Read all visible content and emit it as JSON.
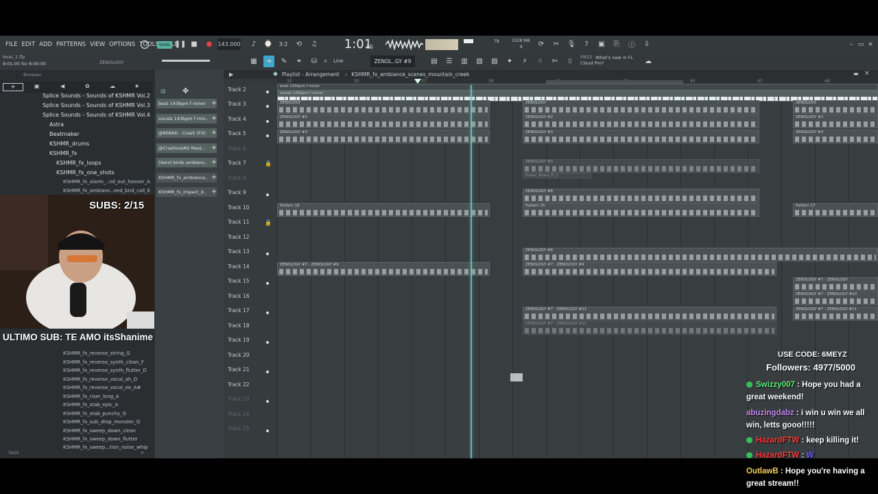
{
  "menu": [
    "FILE",
    "EDIT",
    "ADD",
    "PATTERNS",
    "VIEW",
    "OPTIONS",
    "TOOLS",
    "HELP"
  ],
  "transport": {
    "song_badge": "SONG",
    "tempo": "143.000",
    "time": "1:01",
    "time_ms": "85",
    "pattern": "ZENOL..GY #9",
    "cpu": "3328 MB",
    "cpu2": "6",
    "cpu_top": "78",
    "news_date": "09/12",
    "news": "What's new in FL Cloud Pro?"
  },
  "toolbar2": {
    "snap": "Line"
  },
  "browser": {
    "file_name": "beat_2.flp",
    "time_info": "9:01:00 for 8:00:00",
    "user": "ZENOLOGY",
    "title": "Browser",
    "folders": [
      "Splice Sounds - Sounds of KSHMR Vol.2",
      "Splice Sounds - Sounds of KSHMR Vol.3",
      "Splice Sounds - Sounds of KSHMR Vol.4",
      "Astra",
      "Beatmaker",
      "KSHMR_drums",
      "KSHMR_fx",
      "KSHMR_fx_loops",
      "KSHMR_fx_one_shots"
    ],
    "files_top": [
      "KSHMR_fx_alarm_..nd_out_hoover_A",
      "KSHMR_fx_ambianc..ned_bird_call_E"
    ],
    "files_bottom": [
      "KSHMR_fx_reverse_string_G",
      "KSHMR_fx_reverse_synth_clean_F",
      "KSHMR_fx_reverse_synth_flutter_D",
      "KSHMR_fx_reverse_vocal_ah_D",
      "KSHMR_fx_reverse_vocal_ee_A#",
      "KSHMR_fx_riser_long_A",
      "KSHMR_fx_stab_epic_A",
      "KSHMR_fx_stab_punchy_G",
      "KSHMR_fx_sub_drop_monster_G",
      "KSHMR_fx_sweep_down_clean",
      "KSHMR_fx_sweep_down_flutter",
      "KSHMR_fx_sweep...tion_noise_whip"
    ],
    "tags": "TAGS"
  },
  "channels": [
    "beat 143bpm f minor",
    "vocals 143bpm f min..",
    "@808AD - Crash (FX)",
    "@CrashoutAD  MaxL..",
    "(Xero) birds ambienc..",
    "KSHMR_fx_ambiance..",
    "KSHMR_fx_impact_d.."
  ],
  "playlist": {
    "title": "Playlist - Arrangement",
    "pattern": "KSHMR_fx_ambiance_scenes_mountain_creek",
    "ruler": [
      "33",
      "35",
      "37",
      "39",
      "41",
      "43",
      "45",
      "47",
      "49"
    ],
    "tracks": [
      "Track 2",
      "Track 3",
      "Track 4",
      "Track 5",
      "Track 6",
      "Track 7",
      "Track 8",
      "Track 9",
      "Track 10",
      "Track 11",
      "Track 12",
      "Track 13",
      "Track 14",
      "Track 15",
      "Track 16",
      "Track 17",
      "Track 18",
      "Track 19",
      "Track 20",
      "Track 21",
      "Track 22",
      "Track 23",
      "Track 24",
      "Track 25"
    ],
    "clips": {
      "vocals": "vocals 143bpm f minor",
      "beat": "beat 143bpm f minor",
      "z": "ZENOLOGY",
      "z2": "ZENOLOGY #2",
      "z3": "ZENOLOGY #3",
      "z6": "ZENOLOGY #6",
      "z7_9": "ZENOLOGY #7 - ZENOLOGY #9",
      "z7_11": "ZENOLOGY #7 - ZENOLOGY #11",
      "z7_10": "ZENOLOGY #7 - ZENOLOGY #10",
      "z7z": "ZENOLOGY #7 - ZENOLOGY",
      "p16": "Pattern 16",
      "p15": "Pattern 15",
      "p17": "Pattern 17",
      "pbrass": "Power_Brass_Fi_1"
    }
  },
  "overlay": {
    "subs": "SUBS: 2/15",
    "last_sub": "ULTIMO SUB: TE AMO itsShanime",
    "code": "USE CODE: 6MEYZ",
    "followers": "Followers: 4977/5000"
  },
  "chat": [
    {
      "user": "Swizzy007",
      "color": "#5ef07a",
      "msg": "Hope you had a",
      "msg2": "great weekend!",
      "check": true
    },
    {
      "user": "abuzingdabz",
      "color": "#c78af2",
      "msg": "i win u win we all",
      "msg2": "win, letts gooo!!!!!",
      "check": false
    },
    {
      "user": "HazardFTW",
      "color": "#ff3b3b",
      "msg": "keep killing it!",
      "check": true
    },
    {
      "user": "HazardFTW",
      "color": "#ff3b3b",
      "msg": "W",
      "check": true
    },
    {
      "user": "OutlawB",
      "color": "#f3d35a",
      "msg": "Hope you're having a",
      "msg2": "great stream!!",
      "check": false
    }
  ],
  "colors": {
    "accent": "#7fd0bd",
    "panel": "#2f3336",
    "chat_check": "#35c05a"
  }
}
